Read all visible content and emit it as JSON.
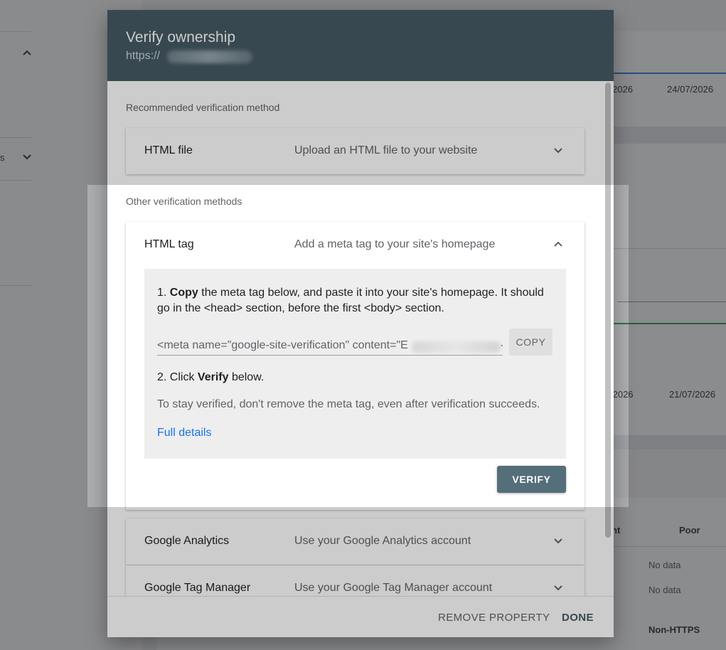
{
  "background": {
    "dates_top": [
      "2026",
      "24/07/2026"
    ],
    "dates_bottom": [
      "/2026",
      "21/07/2026"
    ],
    "table_headers": [
      "nt",
      "Poor"
    ],
    "table_values": [
      "No data",
      "No data"
    ],
    "table_footer": "Non-HTTPS",
    "left_fragment": "s"
  },
  "dialog": {
    "title": "Verify ownership",
    "url_prefix": "https://",
    "recommended_label": "Recommended verification method",
    "other_label": "Other verification methods",
    "methods": [
      {
        "name": "HTML file",
        "description": "Upload an HTML file to your website"
      },
      {
        "name": "HTML tag",
        "description": "Add a meta tag to your site's homepage"
      },
      {
        "name": "Google Analytics",
        "description": "Use your Google Analytics account"
      },
      {
        "name": "Google Tag Manager",
        "description": "Use your Google Tag Manager account"
      }
    ],
    "html_tag": {
      "step1_prefix": "1. ",
      "step1_bold": "Copy",
      "step1_rest": " the meta tag below, and paste it into your site's homepage. It should go in the <head> section, before the first <body> section.",
      "meta_code": "<meta name=\"google-site-verification\" content=\"E",
      "meta_code_tail": "-",
      "copy_label": "COPY",
      "step2_prefix": "2. Click ",
      "step2_bold": "Verify",
      "step2_rest": " below.",
      "note": "To stay verified, don't remove the meta tag, even after verification succeeds.",
      "full_details": "Full details",
      "verify_label": "VERIFY"
    },
    "footer": {
      "remove_label": "REMOVE PROPERTY",
      "done_label": "DONE"
    }
  }
}
